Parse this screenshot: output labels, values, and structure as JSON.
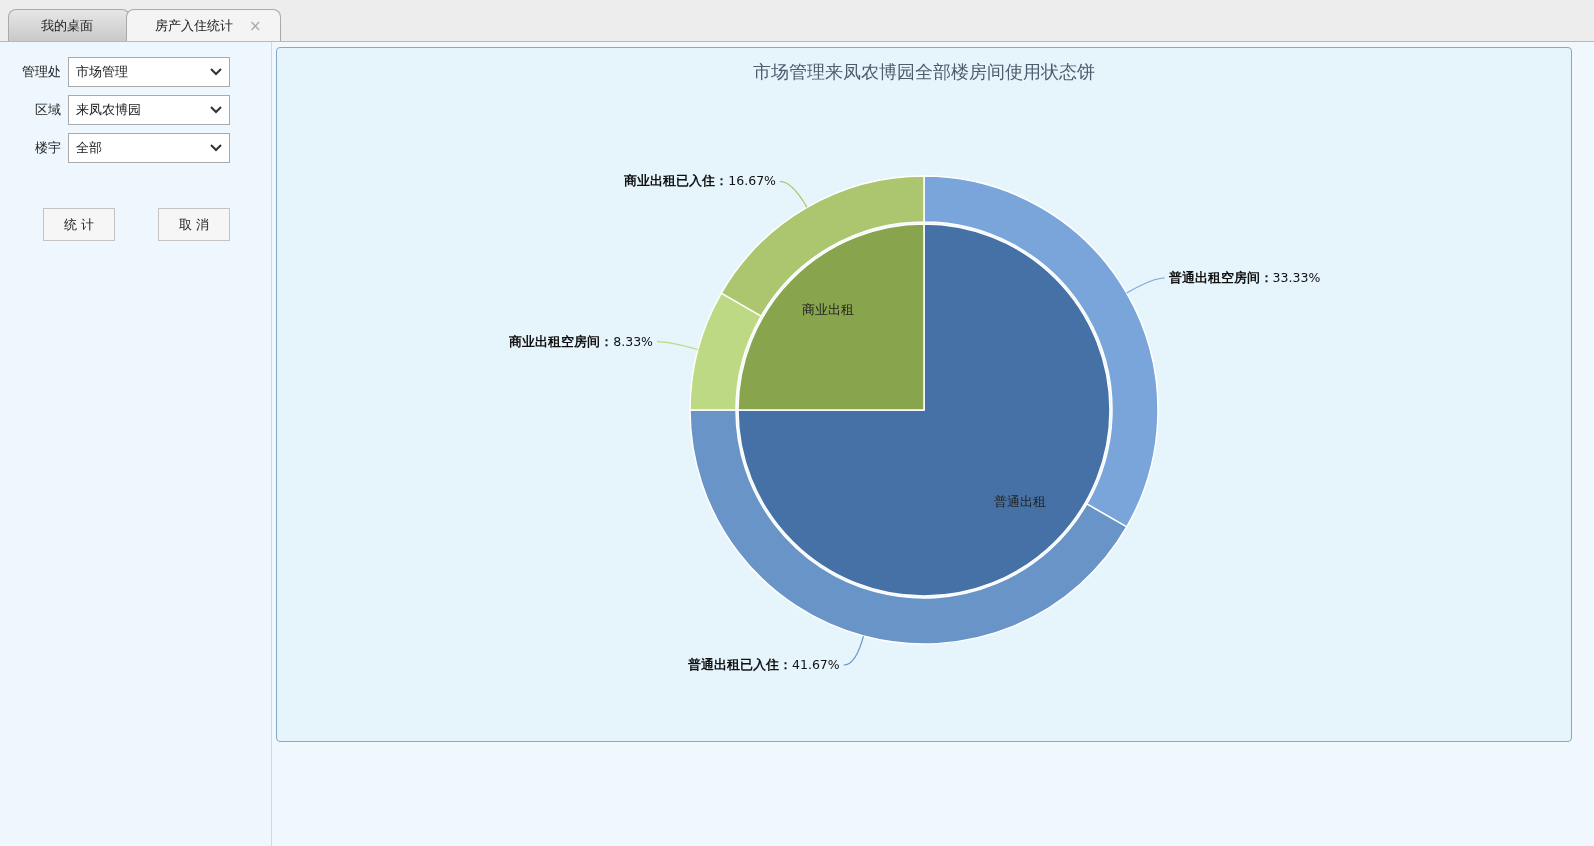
{
  "tabs": [
    {
      "label": "我的桌面",
      "selected": false,
      "closable": false
    },
    {
      "label": "房产入住统计",
      "selected": true,
      "closable": true,
      "close": "×"
    }
  ],
  "filters": [
    {
      "label": "管理处",
      "value": "市场管理"
    },
    {
      "label": "区域",
      "value": "来凤农博园"
    },
    {
      "label": "楼宇",
      "value": "全部"
    }
  ],
  "buttons": [
    "统 计",
    "取 消"
  ],
  "chart": {
    "chart_data": {
      "type": "donut",
      "title": "市场管理来凤农博园全部楼房间使用状态饼",
      "values": [
        33.33,
        41.67,
        8.33,
        16.67
      ],
      "value_labels": [
        "**普通出租空房间：**33.33%",
        "**普通出租已入住：**41.67%",
        "**商业出租空房间：**8.33%",
        "**商业出租已入住：**16.67%"
      ],
      "colors": [
        "#79a5da",
        "#6894c8",
        "#bed983",
        "#abc66e"
      ]
    },
    "inner_ring": {
      "chart_data": {
        "type": "pie",
        "categories": [
          "普通出租",
          "商业出租"
        ],
        "values": [
          75,
          25
        ],
        "colors": [
          "#4571a6",
          "#88a44c"
        ]
      }
    }
  }
}
